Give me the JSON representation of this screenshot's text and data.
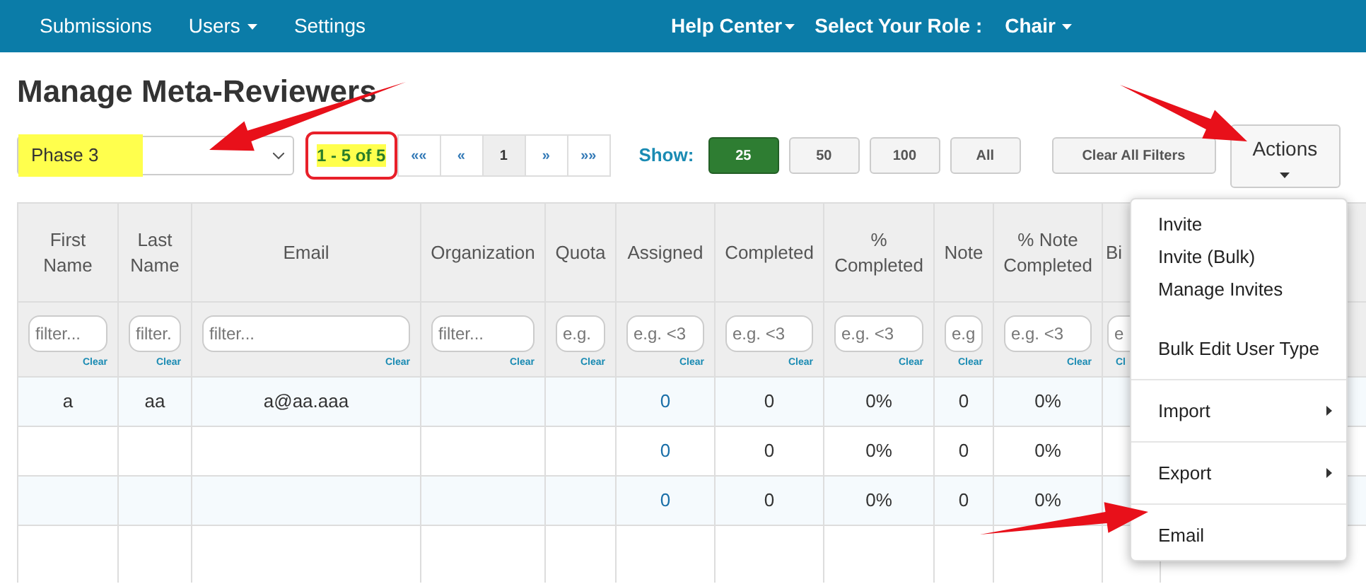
{
  "nav": {
    "items": [
      {
        "label": "Submissions",
        "dropdown": false
      },
      {
        "label": "Users",
        "dropdown": true
      },
      {
        "label": "Settings",
        "dropdown": false
      }
    ],
    "help": {
      "label": "Help Center",
      "dropdown": true
    },
    "role_label": "Select Your Role :",
    "role": {
      "label": "Chair",
      "dropdown": true
    }
  },
  "title": "Manage Meta-Reviewers",
  "toolbar": {
    "phase_select": {
      "value": "Phase 3"
    },
    "count": "1 - 5 of 5",
    "pages": [
      {
        "label": "««",
        "selected": false
      },
      {
        "label": "«",
        "selected": false
      },
      {
        "label": "1",
        "selected": true
      },
      {
        "label": "»",
        "selected": false
      },
      {
        "label": "»»",
        "selected": false
      }
    ],
    "show_label": "Show:",
    "show_options": [
      {
        "label": "25",
        "selected": true
      },
      {
        "label": "50",
        "selected": false
      },
      {
        "label": "100",
        "selected": false
      },
      {
        "label": "All",
        "selected": false
      }
    ],
    "clear_filters": "Clear All Filters",
    "actions": "Actions"
  },
  "table": {
    "columns": [
      {
        "header": "First Name",
        "placeholder": "filter...",
        "clear": "Clear",
        "kind": "text"
      },
      {
        "header": "Last Name",
        "placeholder": "filter.",
        "clear": "Clear",
        "kind": "text"
      },
      {
        "header": "Email",
        "placeholder": "filter...",
        "clear": "Clear",
        "kind": "text"
      },
      {
        "header": "Organization",
        "placeholder": "filter...",
        "clear": "Clear",
        "kind": "text"
      },
      {
        "header": "Quota",
        "placeholder": "e.g.",
        "clear": "Clear",
        "kind": "text"
      },
      {
        "header": "Assigned",
        "placeholder": "e.g. <3",
        "clear": "Clear",
        "kind": "link"
      },
      {
        "header": "Completed",
        "placeholder": "e.g. <3",
        "clear": "Clear",
        "kind": "text"
      },
      {
        "header": "% Completed",
        "placeholder": "e.g. <3",
        "clear": "Clear",
        "kind": "text"
      },
      {
        "header": "Note",
        "placeholder": "e.g",
        "clear": "Clear",
        "kind": "text"
      },
      {
        "header": "% Note Completed",
        "placeholder": "e.g. <3",
        "clear": "Clear",
        "kind": "text"
      },
      {
        "header": "Bi",
        "placeholder": "e",
        "clear": "Cl",
        "kind": "text"
      }
    ],
    "rows": [
      {
        "cells": [
          "a",
          "aa",
          "a@aa.aaa",
          null,
          null,
          "0",
          "0",
          "0%",
          "0",
          "0%",
          null
        ]
      },
      {
        "cells": [
          null,
          null,
          null,
          null,
          null,
          "0",
          "0",
          "0%",
          "0",
          "0%",
          null
        ]
      },
      {
        "cells": [
          null,
          null,
          null,
          null,
          null,
          "0",
          "0",
          "0%",
          "0",
          "0%",
          null
        ]
      }
    ]
  },
  "menu": {
    "items": [
      {
        "label": "Invite",
        "kind": "item"
      },
      {
        "label": "Invite (Bulk)",
        "kind": "item"
      },
      {
        "label": "Manage Invites",
        "kind": "item"
      },
      {
        "kind": "spacer"
      },
      {
        "label": "Bulk Edit User Type",
        "kind": "item"
      },
      {
        "kind": "divider"
      },
      {
        "label": "Import",
        "kind": "submenu"
      },
      {
        "kind": "divider"
      },
      {
        "label": "Export",
        "kind": "submenu"
      },
      {
        "kind": "divider"
      },
      {
        "label": "Email",
        "kind": "item"
      }
    ]
  }
}
